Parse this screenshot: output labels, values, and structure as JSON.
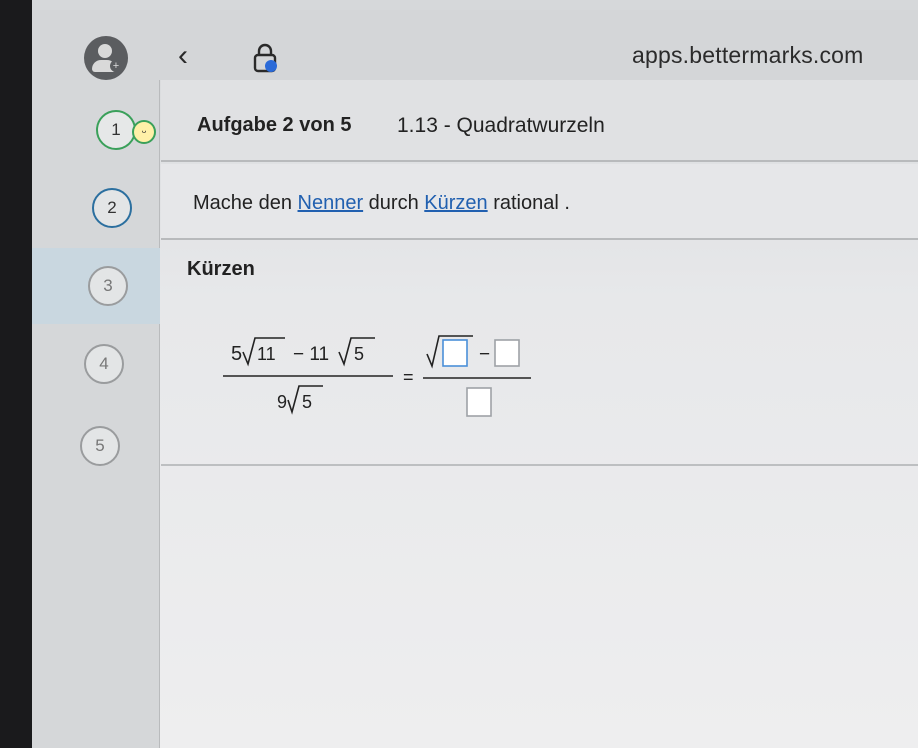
{
  "browser": {
    "url": "apps.bettermarks.com"
  },
  "steps": [
    {
      "number": "1",
      "state": "done"
    },
    {
      "number": "2",
      "state": "current"
    },
    {
      "number": "3",
      "state": "pending"
    },
    {
      "number": "4",
      "state": "pending"
    },
    {
      "number": "5",
      "state": "pending"
    }
  ],
  "header": {
    "task_progress": "Aufgabe 2 von 5",
    "topic": "1.13 - Quadratwurzeln"
  },
  "instruction": {
    "part1": "Mache den ",
    "link1": "Nenner",
    "part2": " durch ",
    "link2": "Kürzen",
    "part3": " rational ."
  },
  "section": {
    "title": "Kürzen"
  },
  "formula": {
    "lhs_num_coef1": "5",
    "lhs_num_rad1": "11",
    "lhs_num_op": "− 11",
    "lhs_num_rad2": "5",
    "lhs_den_coef": "9",
    "lhs_den_rad": "5",
    "equals": "=",
    "rhs_minus": "−"
  },
  "colors": {
    "link": "#2160b0",
    "input_box": "#4a8fd8",
    "step_done": "#3aa05a",
    "step_current": "#2b6f9f"
  }
}
